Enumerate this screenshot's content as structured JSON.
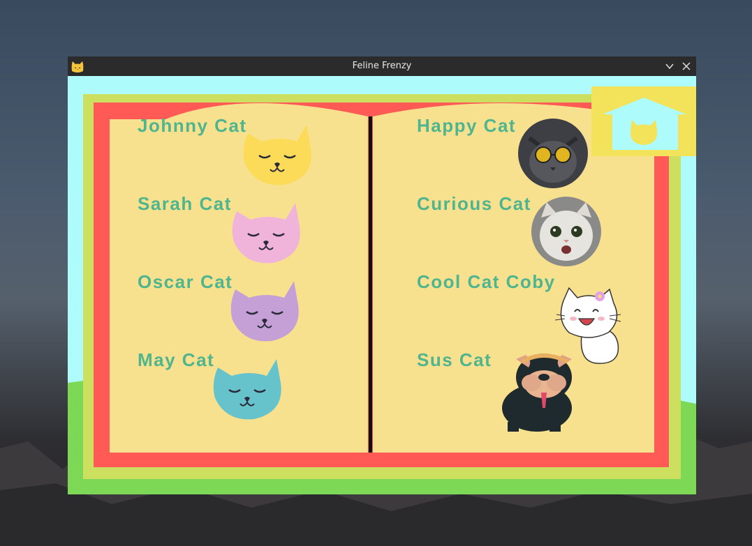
{
  "window": {
    "title": "Feline Frenzy"
  },
  "icons": {
    "app": "cat-face-icon",
    "minimize": "chevron-down-icon",
    "close": "close-icon",
    "home": "home-icon"
  },
  "left_page": {
    "cats": [
      {
        "name": "Johnny Cat",
        "color": "#fbdb57"
      },
      {
        "name": "Sarah Cat",
        "color": "#f0b3d9"
      },
      {
        "name": "Oscar Cat",
        "color": "#c5a0d6"
      },
      {
        "name": "May Cat",
        "color": "#67c3cb"
      }
    ]
  },
  "right_page": {
    "cats": [
      {
        "name": "Happy Cat"
      },
      {
        "name": "Curious Cat"
      },
      {
        "name": "Cool Cat Coby"
      },
      {
        "name": "Sus Cat"
      }
    ]
  },
  "colors": {
    "sky": "#adfbfb",
    "grass": "#7dd955",
    "book_border_outer": "#cddf5f",
    "book_cover": "#ff5a55",
    "page": "#f8e18e",
    "label": "#4fb58e",
    "home_button": "#f2e35a",
    "home_house": "#adfbfb"
  }
}
